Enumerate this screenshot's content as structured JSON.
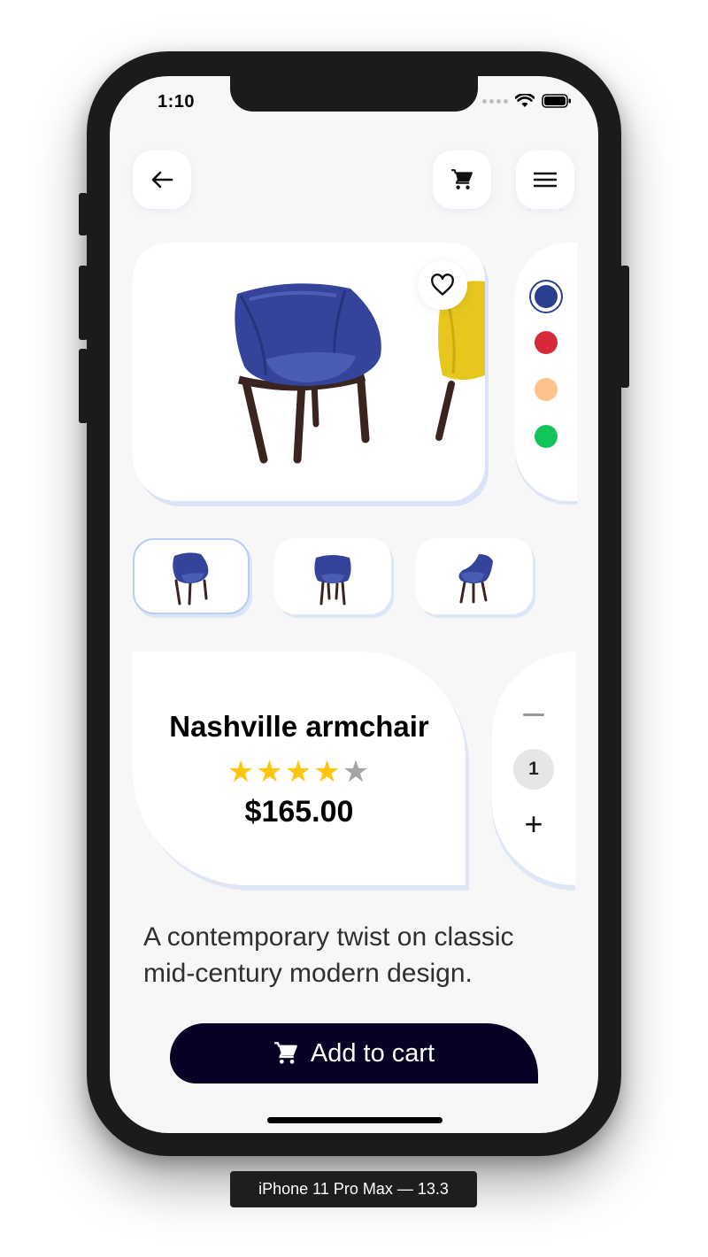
{
  "status_bar": {
    "time": "1:10"
  },
  "nav": {
    "back_icon": "arrow-left-icon",
    "cart_icon": "cart-icon",
    "menu_icon": "menu-icon"
  },
  "product": {
    "name": "Nashville armchair",
    "rating": 4,
    "rating_max": 5,
    "price": "$165.00",
    "description": "A contemporary twist on classic mid-century modern design.",
    "colors": [
      "#2b3f8f",
      "#d42a3a",
      "#ffc187",
      "#11c55a"
    ],
    "selected_color_index": 0
  },
  "quantity": {
    "minus_label": "—",
    "value": "1",
    "plus_label": "+"
  },
  "add_to_cart": {
    "label": "Add to cart"
  },
  "device_label": "iPhone 11 Pro Max — 13.3",
  "colors": {
    "accent_dark": "#090124",
    "star": "#ffc40d",
    "star_empty": "#a5a5a5"
  }
}
